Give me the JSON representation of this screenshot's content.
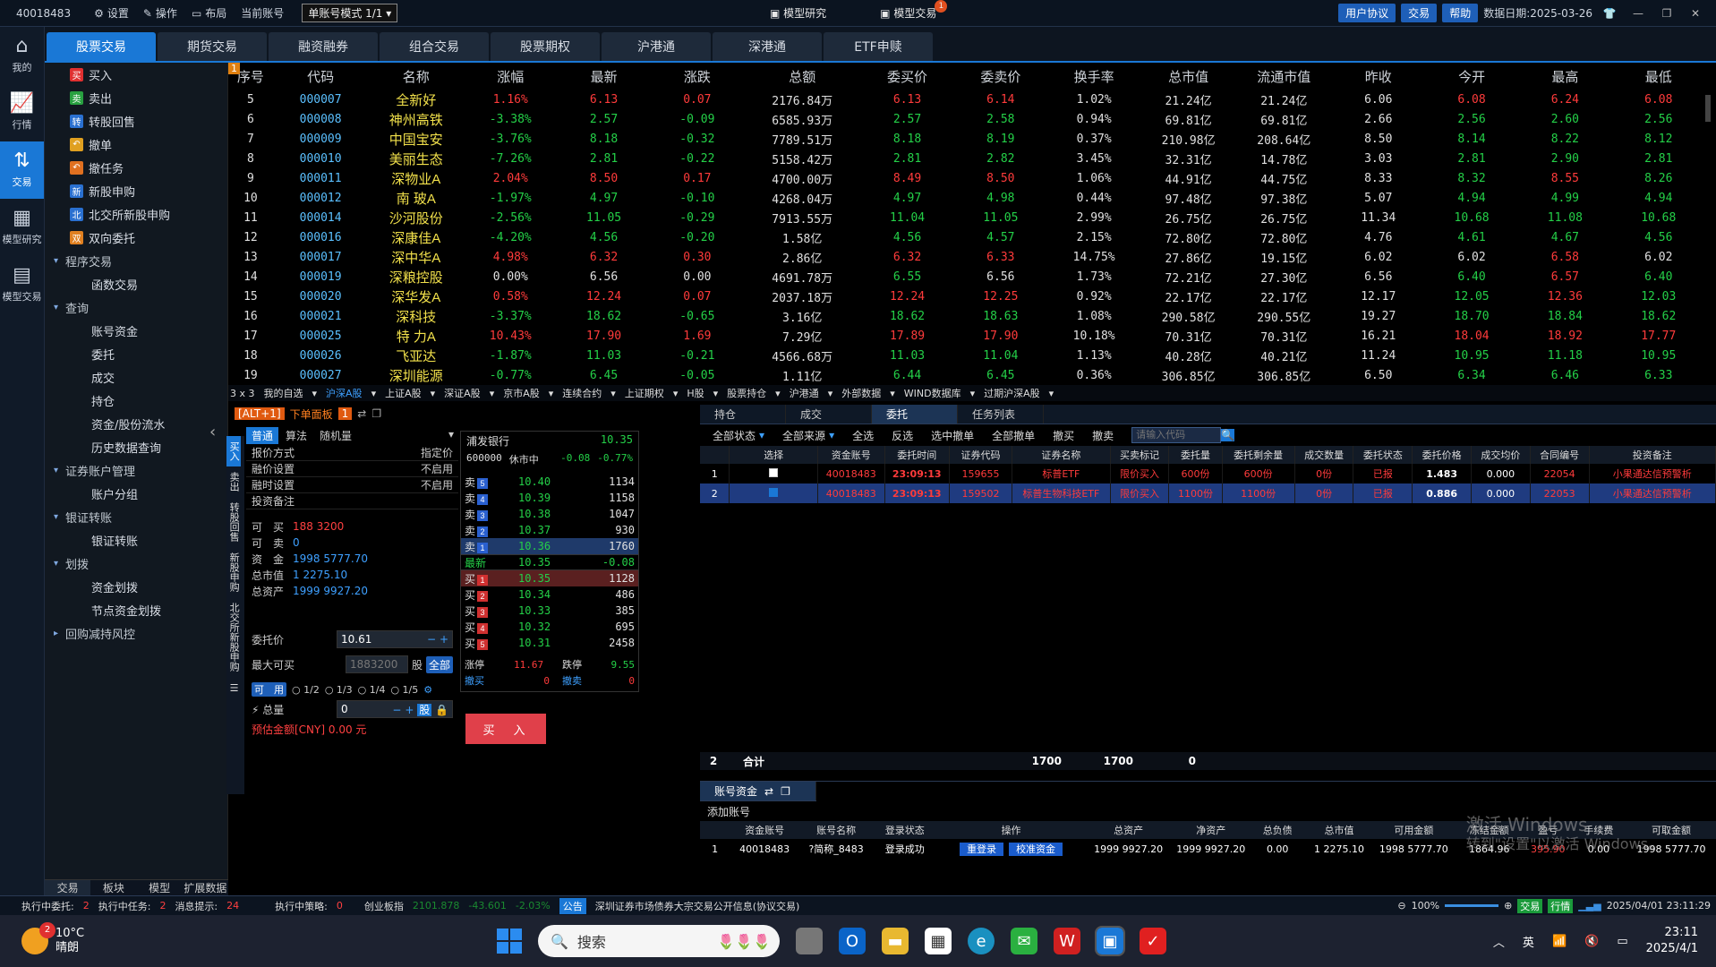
{
  "titlebar": {
    "account": "40018483",
    "settings": "设置",
    "operate": "操作",
    "layout": "布局",
    "current_account_label": "当前账号",
    "account_mode": "单账号模式 1/1",
    "model_research": "模型研究",
    "model_trade": "模型交易",
    "model_trade_badge": "1",
    "user_agreement": "用户协议",
    "trade": "交易",
    "help": "帮助",
    "data_date": "数据日期:2025-03-26"
  },
  "leftnav": [
    {
      "icon": "home-icon",
      "label": "我的"
    },
    {
      "icon": "chart-icon",
      "label": "行情"
    },
    {
      "icon": "trade-icon",
      "label": "交易",
      "active": true
    },
    {
      "icon": "model-research-icon",
      "label": "模型研究"
    },
    {
      "icon": "model-trade-icon",
      "label": "模型交易"
    }
  ],
  "tabs": [
    "股票交易",
    "期货交易",
    "融资融券",
    "组合交易",
    "股票期权",
    "沪港通",
    "深港通",
    "ETF申赎"
  ],
  "tree": {
    "items": [
      {
        "label": "买入",
        "color": "#e03030",
        "glyph": "买"
      },
      {
        "label": "卖出",
        "color": "#28a040",
        "glyph": "卖"
      },
      {
        "label": "转股回售",
        "color": "#2a70d0",
        "glyph": "转"
      },
      {
        "label": "撤单",
        "color": "#e0a020",
        "glyph": "↶"
      },
      {
        "label": "撤任务",
        "color": "#e07020",
        "glyph": "↶"
      },
      {
        "label": "新股申购",
        "color": "#2a70d0",
        "glyph": "新"
      },
      {
        "label": "北交所新股申购",
        "color": "#2a70d0",
        "glyph": "北"
      },
      {
        "label": "双向委托",
        "color": "#e08020",
        "glyph": "双"
      }
    ],
    "groups": [
      {
        "label": "程序交易",
        "children": [
          "函数交易"
        ]
      },
      {
        "label": "查询",
        "children": [
          "账号资金",
          "委托",
          "成交",
          "持仓",
          "资金/股份流水",
          "历史数据查询"
        ]
      },
      {
        "label": "证券账户管理",
        "children": [
          "账户分组"
        ]
      },
      {
        "label": "银证转账",
        "children": [
          "银证转账"
        ]
      },
      {
        "label": "划拨",
        "children": [
          "资金划拨",
          "节点资金划拨"
        ]
      },
      {
        "label": "回购减持风控",
        "children": []
      }
    ],
    "bottom_tabs": [
      "交易",
      "板块",
      "模型",
      "扩展数据"
    ]
  },
  "quote": {
    "headers": [
      "序号",
      "代码",
      "名称",
      "涨幅",
      "最新",
      "涨跌",
      "总额",
      "委买价",
      "委卖价",
      "换手率",
      "总市值",
      "流通市值",
      "昨收",
      "今开",
      "最高",
      "最低"
    ],
    "rows": [
      [
        "5",
        "000007",
        "全新好",
        "1.16%",
        "6.13",
        "0.07",
        "2176.84万",
        "6.13",
        "6.14",
        "1.02%",
        "21.24亿",
        "21.24亿",
        "6.06",
        "6.08",
        "6.24",
        "6.08"
      ],
      [
        "6",
        "000008",
        "神州高铁",
        "-3.38%",
        "2.57",
        "-0.09",
        "6585.93万",
        "2.57",
        "2.58",
        "0.94%",
        "69.81亿",
        "69.81亿",
        "2.66",
        "2.56",
        "2.60",
        "2.56"
      ],
      [
        "7",
        "000009",
        "中国宝安",
        "-3.76%",
        "8.18",
        "-0.32",
        "7789.51万",
        "8.18",
        "8.19",
        "0.37%",
        "210.98亿",
        "208.64亿",
        "8.50",
        "8.14",
        "8.22",
        "8.12"
      ],
      [
        "8",
        "000010",
        "美丽生态",
        "-7.26%",
        "2.81",
        "-0.22",
        "5158.42万",
        "2.81",
        "2.82",
        "3.45%",
        "32.31亿",
        "14.78亿",
        "3.03",
        "2.81",
        "2.90",
        "2.81"
      ],
      [
        "9",
        "000011",
        "深物业A",
        "2.04%",
        "8.50",
        "0.17",
        "4700.00万",
        "8.49",
        "8.50",
        "1.06%",
        "44.91亿",
        "44.75亿",
        "8.33",
        "8.32",
        "8.55",
        "8.26"
      ],
      [
        "10",
        "000012",
        "南 玻A",
        "-1.97%",
        "4.97",
        "-0.10",
        "4268.04万",
        "4.97",
        "4.98",
        "0.44%",
        "97.48亿",
        "97.38亿",
        "5.07",
        "4.94",
        "4.99",
        "4.94"
      ],
      [
        "11",
        "000014",
        "沙河股份",
        "-2.56%",
        "11.05",
        "-0.29",
        "7913.55万",
        "11.04",
        "11.05",
        "2.99%",
        "26.75亿",
        "26.75亿",
        "11.34",
        "10.68",
        "11.08",
        "10.68"
      ],
      [
        "12",
        "000016",
        "深康佳A",
        "-4.20%",
        "4.56",
        "-0.20",
        "1.58亿",
        "4.56",
        "4.57",
        "2.15%",
        "72.80亿",
        "72.80亿",
        "4.76",
        "4.61",
        "4.67",
        "4.56"
      ],
      [
        "13",
        "000017",
        "深中华A",
        "4.98%",
        "6.32",
        "0.30",
        "2.86亿",
        "6.32",
        "6.33",
        "14.75%",
        "27.86亿",
        "19.15亿",
        "6.02",
        "6.02",
        "6.58",
        "6.02"
      ],
      [
        "14",
        "000019",
        "深粮控股",
        "0.00%",
        "6.56",
        "0.00",
        "4691.78万",
        "6.55",
        "6.56",
        "1.73%",
        "72.21亿",
        "27.30亿",
        "6.56",
        "6.40",
        "6.57",
        "6.40"
      ],
      [
        "15",
        "000020",
        "深华发A",
        "0.58%",
        "12.24",
        "0.07",
        "2037.18万",
        "12.24",
        "12.25",
        "0.92%",
        "22.17亿",
        "22.17亿",
        "12.17",
        "12.05",
        "12.36",
        "12.03"
      ],
      [
        "16",
        "000021",
        "深科技",
        "-3.37%",
        "18.62",
        "-0.65",
        "3.16亿",
        "18.62",
        "18.63",
        "1.08%",
        "290.58亿",
        "290.55亿",
        "19.27",
        "18.70",
        "18.84",
        "18.62"
      ],
      [
        "17",
        "000025",
        "特 力A",
        "10.43%",
        "17.90",
        "1.69",
        "7.29亿",
        "17.89",
        "17.90",
        "10.18%",
        "70.31亿",
        "70.31亿",
        "16.21",
        "18.04",
        "18.92",
        "17.77"
      ],
      [
        "18",
        "000026",
        "飞亚达",
        "-1.87%",
        "11.03",
        "-0.21",
        "4566.68万",
        "11.03",
        "11.04",
        "1.13%",
        "40.28亿",
        "40.21亿",
        "11.24",
        "10.95",
        "11.18",
        "10.95"
      ],
      [
        "19",
        "000027",
        "深圳能源",
        "-0.77%",
        "6.45",
        "-0.05",
        "1.11亿",
        "6.44",
        "6.45",
        "0.36%",
        "306.85亿",
        "306.85亿",
        "6.50",
        "6.34",
        "6.46",
        "6.33"
      ]
    ],
    "corner_badge": "1",
    "bar": [
      "3 x 3",
      "我的自选",
      "沪深A股",
      "上证A股",
      "深证A股",
      "京市A股",
      "连续合约",
      "上证期权",
      "H股",
      "股票持仓",
      "沪港通",
      "外部数据",
      "WIND数据库",
      "过期沪深A股"
    ]
  },
  "order_panel": {
    "hotkey": "[ALT+1]",
    "title": "下单面板",
    "badge": "1",
    "vtabs": [
      "买入",
      "卖出",
      "转股回售",
      "新股申购",
      "北交所新股申购"
    ],
    "mode_tabs": [
      "普通",
      "算法"
    ],
    "algo_value": "随机量",
    "settings": [
      {
        "k": "报价方式",
        "v": "指定价"
      },
      {
        "k": "融价设置",
        "v": "不启用"
      },
      {
        "k": "融时设置",
        "v": "不启用"
      },
      {
        "k": "投资备注",
        "v": ""
      }
    ],
    "stats": [
      {
        "k": "可　买",
        "v": "188 3200"
      },
      {
        "k": "可　卖",
        "v": "0"
      },
      {
        "k": "资　金",
        "v": "1998 5777.70"
      },
      {
        "k": "总市值",
        "v": "1 2275.10"
      },
      {
        "k": "总资产",
        "v": "1999 9927.20"
      }
    ],
    "price_label": "委托价",
    "price": "10.61",
    "maxbuy_label": "最大可买",
    "maxbuy": "1883200",
    "unit": "股",
    "all": "全部",
    "ratio": [
      "可　用",
      "1/2",
      "1/3",
      "1/4",
      "1/5"
    ],
    "total_label": "总量",
    "total": "0",
    "estimate": "预估金额[CNY] 0.00 元",
    "buy_button": "买　入"
  },
  "depth": {
    "name": "浦发银行",
    "last": "10.35",
    "code": "600000",
    "status": "休市中",
    "chg": "-0.08",
    "pct": "-0.77%",
    "asks": [
      [
        "5",
        "10.40",
        "1134"
      ],
      [
        "4",
        "10.39",
        "1158"
      ],
      [
        "3",
        "10.38",
        "1047"
      ],
      [
        "2",
        "10.37",
        "930"
      ],
      [
        "1",
        "10.36",
        "1760"
      ]
    ],
    "latest_label": "最新",
    "latest": "10.35",
    "latest_chg": "-0.08",
    "bids": [
      [
        "1",
        "10.35",
        "1128"
      ],
      [
        "2",
        "10.34",
        "486"
      ],
      [
        "3",
        "10.33",
        "385"
      ],
      [
        "4",
        "10.32",
        "695"
      ],
      [
        "5",
        "10.31",
        "2458"
      ]
    ],
    "limit_up_label": "涨停",
    "limit_up": "11.67",
    "limit_dn_label": "跌停",
    "limit_dn": "9.55",
    "cancel_buy": "撤买",
    "cancel_buy_v": "0",
    "cancel_sell": "撤卖",
    "cancel_sell_v": "0"
  },
  "orders": {
    "tabs": [
      "持仓",
      "成交",
      "委托",
      "任务列表"
    ],
    "toolbar": [
      "全部状态",
      "全部来源",
      "全选",
      "反选",
      "选中撤单",
      "全部撤单",
      "撤买",
      "撤卖"
    ],
    "code_placeholder": "请输入代码",
    "headers": [
      "",
      "选择",
      "资金账号",
      "委托时间",
      "证券代码",
      "证券名称",
      "买卖标记",
      "委托量",
      "委托剩余量",
      "成交数量",
      "委托状态",
      "委托价格",
      "成交均价",
      "合同编号",
      "投资备注"
    ],
    "rows": [
      [
        "1",
        false,
        "40018483",
        "23:09:13",
        "159655",
        "标普ETF",
        "限价买入",
        "600份",
        "600份",
        "0份",
        "已报",
        "1.483",
        "0.000",
        "22054",
        "小果通达信预警析"
      ],
      [
        "2",
        true,
        "40018483",
        "23:09:13",
        "159502",
        "标普生物科技ETF",
        "限价买入",
        "1100份",
        "1100份",
        "0份",
        "已报",
        "0.886",
        "0.000",
        "22053",
        "小果通达信预警析"
      ]
    ],
    "sum_count": "2",
    "sum_label": "合计",
    "sum_qty": "1700",
    "sum_remain": "1700",
    "sum_deal": "0"
  },
  "account": {
    "tab": "账号资金",
    "add": "添加账号",
    "headers": [
      "",
      "资金账号",
      "账号名称",
      "登录状态",
      "操作",
      "总资产",
      "净资产",
      "总负债",
      "总市值",
      "可用金额",
      "冻结金额",
      "盈亏",
      "手续费",
      "可取金额"
    ],
    "row": [
      "1",
      "40018483",
      "?简称_8483",
      "登录成功",
      "重登录",
      "校准资金",
      "1999 9927.20",
      "1999 9927.20",
      "0.00",
      "1 2275.10",
      "1998 5777.70",
      "1864.96",
      "395.90",
      "0.00",
      "1998 5777.70"
    ]
  },
  "watermark": {
    "line1": "激活 Windows",
    "line2": "转到\"设置\"以激活 Windows。"
  },
  "status": {
    "exec_order": "执行中委托:",
    "exec_order_v": "2",
    "exec_task": "执行中任务:",
    "exec_task_v": "2",
    "msg": "消息提示:",
    "msg_v": "24",
    "exec_strategy": "执行中策略:",
    "exec_strategy_v": "0",
    "index_name": "创业板指",
    "index_val": "2101.878",
    "index_chg": "-43.601",
    "index_pct": "-2.03%",
    "notice_tag": "公告",
    "notice": "深圳证券市场债券大宗交易公开信息(协议交易)",
    "zoom": "100%",
    "trade": "交易",
    "market": "行情",
    "datetime": "2025/04/01 23:11:29"
  },
  "taskbar": {
    "temp": "10°C",
    "weather": "晴朗",
    "badge": "2",
    "search": "搜索",
    "ime": "英",
    "time": "23:11",
    "date": "2025/4/1"
  }
}
